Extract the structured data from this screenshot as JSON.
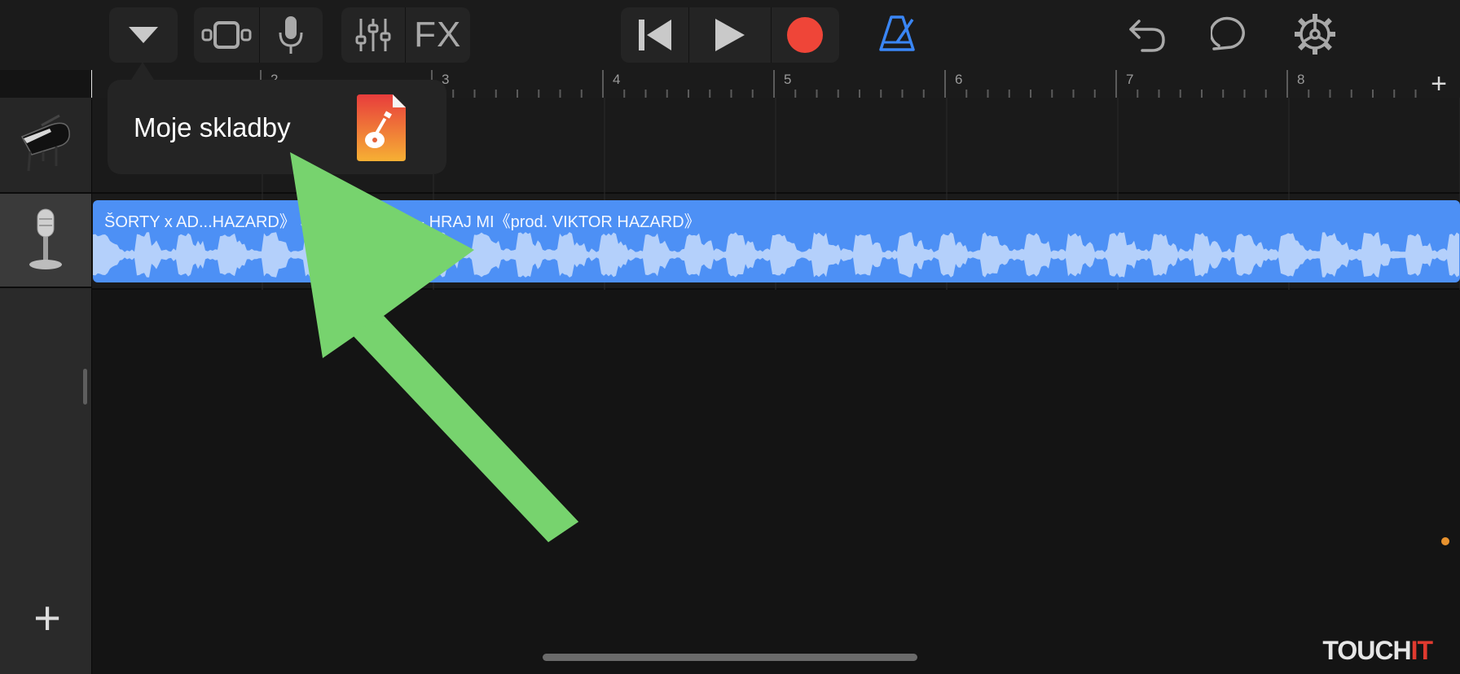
{
  "toolbar": {
    "icons": {
      "dropdown": "chevron-down-icon",
      "tracks_view": "tracks-view-icon",
      "mic": "microphone-icon",
      "mixer": "mixer-sliders-icon",
      "rewind": "go-to-start-icon",
      "play": "play-icon",
      "record": "record-icon",
      "metronome": "metronome-icon",
      "undo": "undo-icon",
      "loop": "loop-browser-icon",
      "settings": "settings-gear-icon"
    },
    "fx_label": "FX"
  },
  "ruler": {
    "bars": [
      "2",
      "3",
      "4",
      "5",
      "6",
      "7",
      "8"
    ],
    "add_label": "+"
  },
  "popup": {
    "label": "Moje skladby",
    "icon": "garageband-file-icon"
  },
  "tracks": [
    {
      "icon": "grand-piano-icon",
      "region_title": ""
    },
    {
      "icon": "studio-microphone-icon",
      "region_title": "ŠORTY x AD...HAZARD》  ŠORTY x ADiss - HRAJ MI《prod. VIKTOR HAZARD》"
    }
  ],
  "sidebar": {
    "add_track_label": "+"
  },
  "brand": {
    "main": "TOUCH",
    "accent": "IT"
  },
  "colors": {
    "background": "#141414",
    "region_blue": "#4d90f5",
    "record_red": "#ef4538",
    "metronome_blue": "#3a86f5",
    "arrow_green": "#77d36e"
  }
}
